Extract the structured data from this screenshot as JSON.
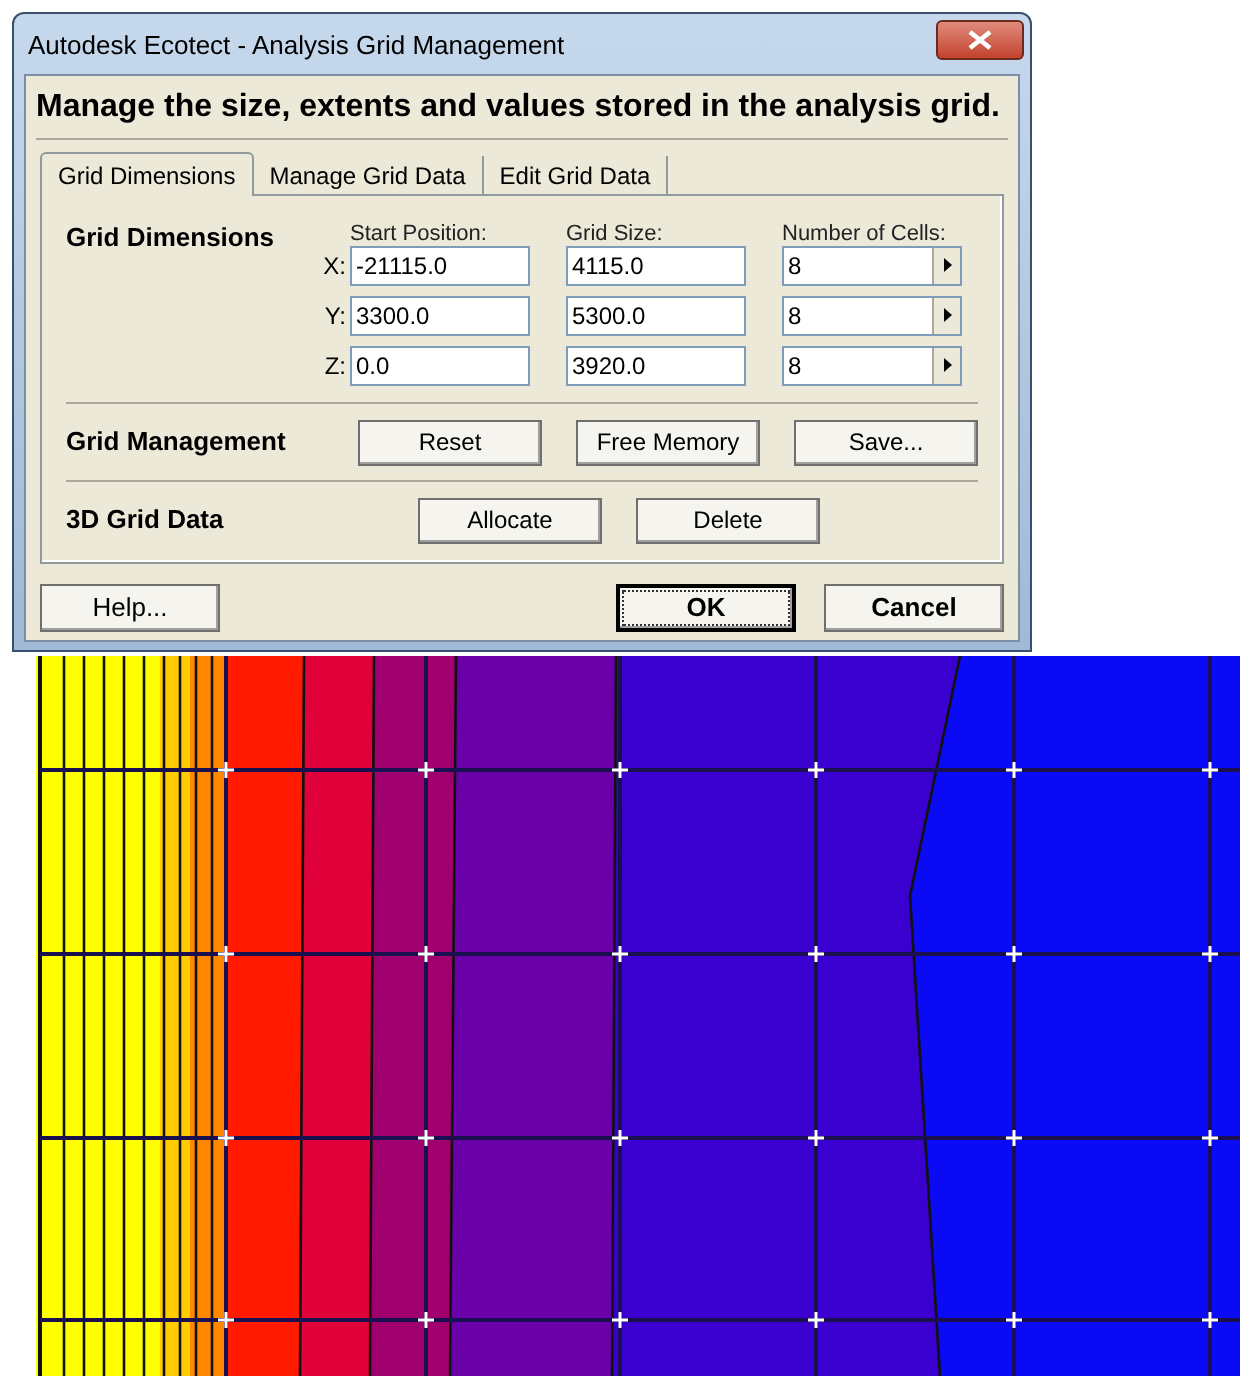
{
  "window": {
    "title": "Autodesk Ecotect - Analysis Grid Management"
  },
  "header": "Manage the size, extents and values stored in the analysis grid.",
  "tabs": [
    {
      "label": "Grid Dimensions",
      "selected": true
    },
    {
      "label": "Manage Grid Data",
      "selected": false
    },
    {
      "label": "Edit Grid Data",
      "selected": false
    }
  ],
  "grid_dimensions": {
    "label": "Grid Dimensions",
    "columns": [
      "Start Position:",
      "Grid Size:",
      "Number of Cells:"
    ],
    "rows": [
      {
        "axis": "X:",
        "start": "-21115.0",
        "size": "4115.0",
        "cells": "8"
      },
      {
        "axis": "Y:",
        "start": "3300.0",
        "size": "5300.0",
        "cells": "8"
      },
      {
        "axis": "Z:",
        "start": "0.0",
        "size": "3920.0",
        "cells": "8"
      }
    ]
  },
  "grid_management": {
    "label": "Grid Management",
    "buttons": [
      "Reset",
      "Free Memory",
      "Save..."
    ]
  },
  "grid_data_3d": {
    "label": "3D Grid Data",
    "buttons": [
      "Allocate",
      "Delete"
    ]
  },
  "footer_buttons": [
    {
      "label": "Help...",
      "focused": false,
      "bold": false
    },
    {
      "label": "OK",
      "focused": true,
      "bold": true
    },
    {
      "label": "Cancel",
      "focused": false,
      "bold": true
    }
  ]
}
